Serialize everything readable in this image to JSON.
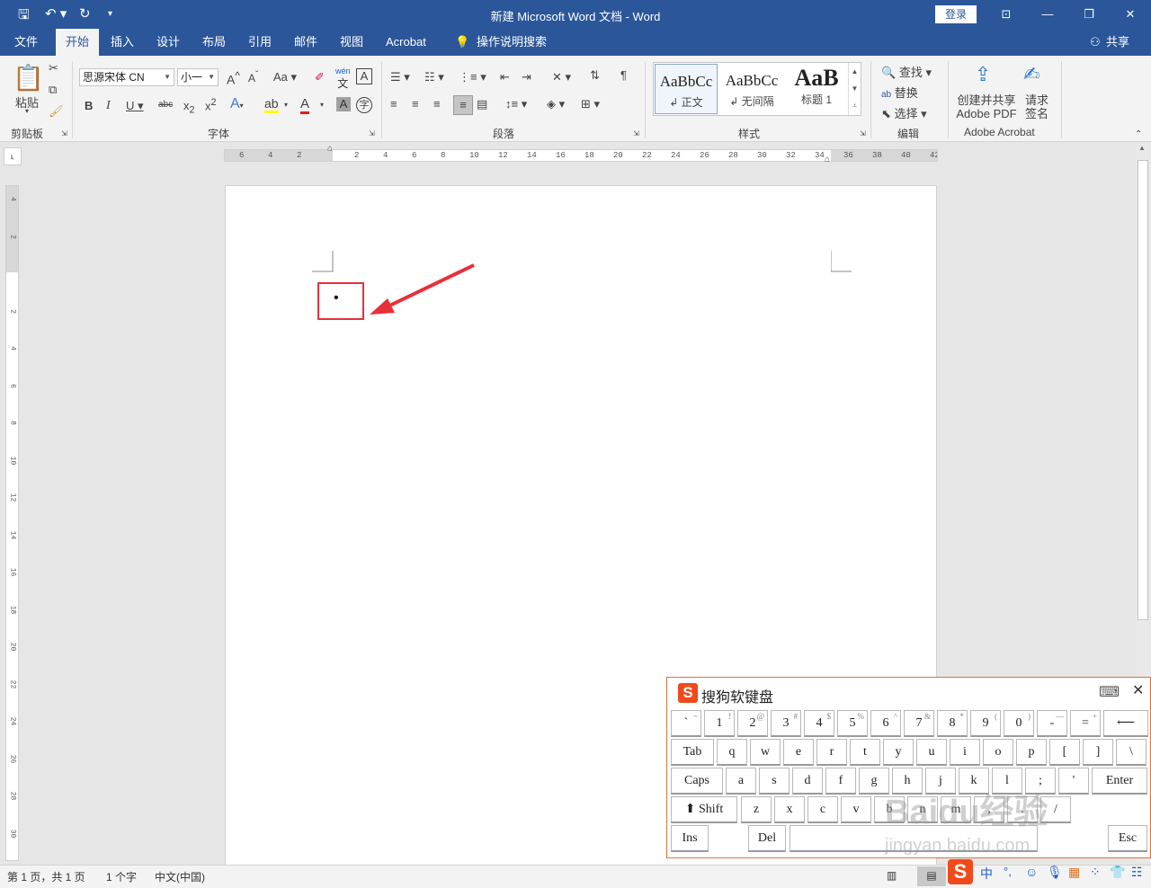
{
  "titlebar": {
    "title": "新建 Microsoft Word 文档 - Word",
    "login": "登录"
  },
  "tabs": [
    "文件",
    "开始",
    "插入",
    "设计",
    "布局",
    "引用",
    "邮件",
    "视图",
    "Acrobat",
    "操作说明搜索"
  ],
  "share": "共享",
  "ribbon": {
    "clipboard": {
      "paste": "粘贴",
      "label": "剪贴板"
    },
    "font": {
      "name": "思源宋体 CN",
      "size": "小一",
      "label": "字体",
      "change_case": "Aa",
      "phonetic": "wén"
    },
    "paragraph": {
      "label": "段落"
    },
    "styles": {
      "label": "样式",
      "items": [
        {
          "preview": "AaBbCc",
          "name": "↲ 正文"
        },
        {
          "preview": "AaBbCc",
          "name": "↲ 无间隔"
        },
        {
          "preview": "AaB",
          "name": "标题 1"
        }
      ]
    },
    "editing": {
      "label": "编辑",
      "find": "查找",
      "replace": "替换",
      "select": "选择"
    },
    "acrobat": {
      "label": "Adobe Acrobat",
      "create_line1": "创建并共享",
      "create_line2": "Adobe PDF",
      "sign_line1": "请求",
      "sign_line2": "签名"
    }
  },
  "ruler": {
    "ticks": [
      "6",
      "4",
      "2",
      "",
      "2",
      "4",
      "6",
      "8",
      "10",
      "12",
      "14",
      "16",
      "18",
      "20",
      "22",
      "24",
      "26",
      "28",
      "30",
      "32",
      "34",
      "36",
      "38",
      "40",
      "42"
    ]
  },
  "vruler": {
    "ticks": [
      "4",
      "2",
      "",
      "2",
      "4",
      "6",
      "8",
      "10",
      "12",
      "14",
      "16",
      "18",
      "20",
      "22",
      "24",
      "26",
      "28",
      "30"
    ]
  },
  "document": {
    "bullet": "•"
  },
  "status": {
    "page": "第 1 页，共 1 页",
    "words": "1 个字",
    "lang": "中文(中国)"
  },
  "keyboard": {
    "title": "搜狗软键盘",
    "row1": [
      [
        "`",
        "~"
      ],
      [
        "1",
        "!"
      ],
      [
        "2",
        "@"
      ],
      [
        "3",
        "#"
      ],
      [
        "4",
        "$"
      ],
      [
        "5",
        "%"
      ],
      [
        "6",
        "^"
      ],
      [
        "7",
        "&"
      ],
      [
        "8",
        "*"
      ],
      [
        "9",
        "("
      ],
      [
        "0",
        ")"
      ],
      [
        "-",
        "—"
      ],
      [
        "=",
        "+"
      ]
    ],
    "backspace": "⟵",
    "row2": [
      "q",
      "w",
      "e",
      "r",
      "t",
      "y",
      "u",
      "i",
      "o",
      "p",
      "[",
      "]",
      "\\"
    ],
    "tab": "Tab",
    "row3": [
      "a",
      "s",
      "d",
      "f",
      "g",
      "h",
      "j",
      "k",
      "l",
      ";",
      "'"
    ],
    "caps": "Caps",
    "enter": "Enter",
    "row4": [
      "z",
      "x",
      "c",
      "v",
      "b",
      "n",
      "m",
      ",",
      ".",
      "/"
    ],
    "shift": "Shift",
    "ins": "Ins",
    "del": "Del",
    "esc": "Esc"
  },
  "tray": {
    "ime": "中",
    "punct": "°,"
  },
  "watermark": {
    "line1": "Baidu经验",
    "line2": "jingyan.baidu.com"
  }
}
